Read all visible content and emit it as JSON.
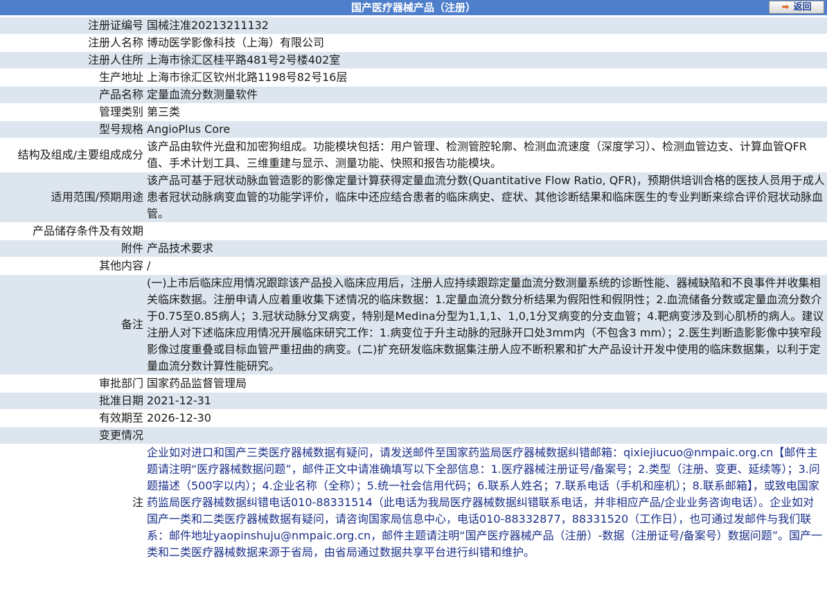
{
  "header": {
    "title": "国产医疗器械产品（注册）",
    "back_label": "返回"
  },
  "rows": [
    {
      "label": "注册证编号",
      "value": "国械注准20213211132"
    },
    {
      "label": "注册人名称",
      "value": "博动医学影像科技（上海）有限公司"
    },
    {
      "label": "注册人住所",
      "value": "上海市徐汇区桂平路481号2号楼402室"
    },
    {
      "label": "生产地址",
      "value": "上海市徐汇区钦州北路1198号82号16层"
    },
    {
      "label": "产品名称",
      "value": "定量血流分数测量软件"
    },
    {
      "label": "管理类别",
      "value": "第三类"
    },
    {
      "label": "型号规格",
      "value": "AngioPlus Core"
    },
    {
      "label": "结构及组成/主要组成成分",
      "value": "该产品由软件光盘和加密狗组成。功能模块包括：用户管理、检测管腔轮廓、检测血流速度（深度学习）、检测血管边支、计算血管QFR值、手术计划工具、三维重建与显示、测量功能、快照和报告功能模块。"
    },
    {
      "label": "适用范围/预期用途",
      "value": "该产品可基于冠状动脉血管造影的影像定量计算获得定量血流分数(Quantitative Flow Ratio, QFR)，预期供培训合格的医技人员用于成人患者冠状动脉病变血管的功能学评价，临床中还应结合患者的临床病史、症状、其他诊断结果和临床医生的专业判断来综合评价冠状动脉血管。"
    },
    {
      "label": "产品储存条件及有效期",
      "value": ""
    },
    {
      "label": "附件",
      "value": "产品技术要求"
    },
    {
      "label": "其他内容",
      "value": "/"
    },
    {
      "label": "备注",
      "value": "(一)上市后临床应用情况跟踪该产品投入临床应用后，注册人应持续跟踪定量血流分数测量系统的诊断性能、器械缺陷和不良事件并收集相关临床数据。注册申请人应着重收集下述情况的临床数据：1.定量血流分数分析结果为假阳性和假阴性；2.血流储备分数或定量血流分数介于0.75至0.85病人；3.冠状动脉分叉病变，特别是Medina分型为1,1,1、1,0,1分叉病变的分支血管；4.靶病变涉及到心肌桥的病人。建议注册人对下述临床应用情况开展临床研究工作：1.病变位于升主动脉的冠脉开口处3mm内（不包含3 mm）；2.医生判断造影影像中狭窄段影像过度重叠或目标血管严重扭曲的病变。(二)扩充研发临床数据集注册人应不断积累和扩大产品设计开发中使用的临床数据集，以利于定量血流分数计算性能研究。"
    },
    {
      "label": "审批部门",
      "value": "国家药品监督管理局"
    },
    {
      "label": "批准日期",
      "value": "2021-12-31"
    },
    {
      "label": "有效期至",
      "value": "2026-12-30"
    },
    {
      "label": "变更情况",
      "value": ""
    },
    {
      "label": "注",
      "value": "企业如对进口和国产三类医疗器械数据有疑问，请发送邮件至国家药监局医疗器械数据纠错邮箱：qixiejiucuo@nmpaic.org.cn【邮件主题请注明“医疗器械数据问题”，邮件正文中请准确填写以下全部信息：1.医疗器械注册证号/备案号；2.类型（注册、变更、延续等）；3.问题描述（500字以内）；4.企业名称（全称）；5.统一社会信用代码；6.联系人姓名；7.联系电话（手机和座机）；8.联系邮箱】，或致电国家药监局医疗器械数据纠错电话010-88331514（此电话为我局医疗器械数据纠错联系电话，并非相应产品/企业业务咨询电话）。企业如对国产一类和二类医疗器械数据有疑问，请咨询国家局信息中心，电话010-88332877，88331520（工作日），也可通过发邮件与我们联系：邮件地址yaopinshuju@nmpaic.org.cn，邮件主题请注明“国产医疗器械产品（注册）-数据（注册证号/备案号）数据问题”。国产一类和二类医疗器械数据来源于省局，由省局通过数据共享平台进行纠错和维护。"
    }
  ],
  "colors": {
    "header_bg": "#4f7ecb",
    "row_alt_bg": "#dde6ef",
    "note_text": "#1a2f8a"
  },
  "icons": {
    "back": "back-arrow-icon"
  }
}
